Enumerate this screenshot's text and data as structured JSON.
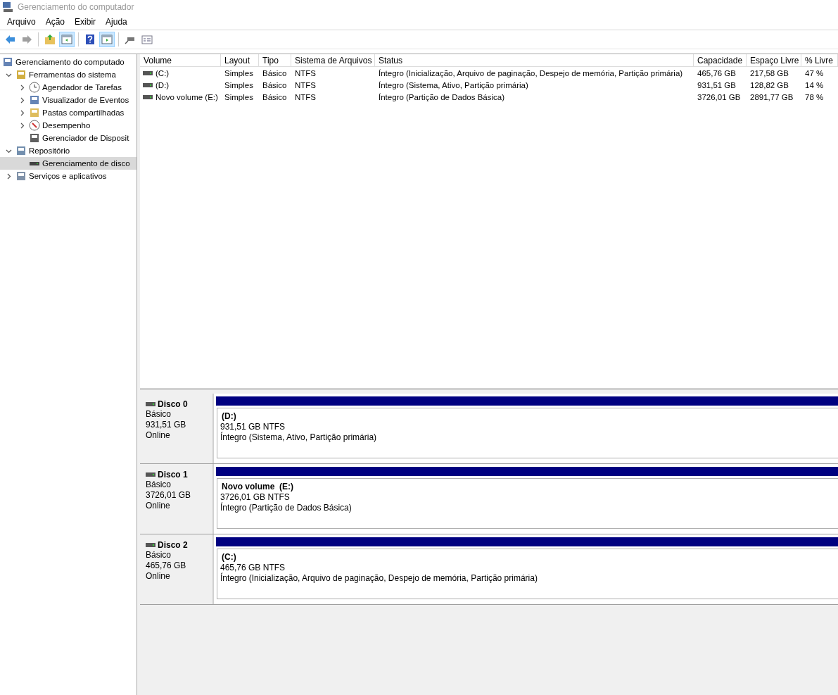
{
  "window": {
    "title": "Gerenciamento do computador"
  },
  "menu": [
    "Arquivo",
    "Ação",
    "Exibir",
    "Ajuda"
  ],
  "toolbar": [
    {
      "kind": "back",
      "pressed": false,
      "disabled": false
    },
    {
      "kind": "forward",
      "pressed": false,
      "disabled": true
    },
    {
      "kind": "separator"
    },
    {
      "kind": "up",
      "pressed": false,
      "disabled": false
    },
    {
      "kind": "tree",
      "pressed": true,
      "disabled": false
    },
    {
      "kind": "separator"
    },
    {
      "kind": "help",
      "pressed": false,
      "disabled": false
    },
    {
      "kind": "pane",
      "pressed": true,
      "disabled": false
    },
    {
      "kind": "separator"
    },
    {
      "kind": "connect",
      "pressed": false,
      "disabled": false
    },
    {
      "kind": "properties",
      "pressed": false,
      "disabled": false
    }
  ],
  "tree": {
    "label": "Gerenciamento do computado",
    "selected": false,
    "children": [
      {
        "label": "Ferramentas do sistema",
        "expanded": true,
        "selected": false,
        "children": [
          {
            "label": "Agendador de Tarefas",
            "expanded": false,
            "selected": false
          },
          {
            "label": "Visualizador de Eventos",
            "expanded": false,
            "selected": false
          },
          {
            "label": "Pastas compartilhadas",
            "expanded": false,
            "selected": false
          },
          {
            "label": "Desempenho",
            "expanded": false,
            "selected": false
          },
          {
            "label": "Gerenciador de Disposit",
            "selected": false
          }
        ]
      },
      {
        "label": "Repositório",
        "expanded": true,
        "selected": false,
        "children": [
          {
            "label": "Gerenciamento de disco",
            "selected": true
          }
        ]
      },
      {
        "label": "Serviços e aplicativos",
        "expanded": false,
        "selected": false
      }
    ]
  },
  "table": {
    "columns": [
      "Volume",
      "Layout",
      "Tipo",
      "Sistema de Arquivos",
      "Status",
      "Capacidade",
      "Espaço Livre",
      "% Livre"
    ],
    "rows": [
      [
        "(C:)",
        "Simples",
        "Básico",
        "NTFS",
        "Íntegro (Inicialização, Arquivo de paginação, Despejo de memória, Partição primária)",
        "465,76 GB",
        "217,58 GB",
        "47 %"
      ],
      [
        "(D:)",
        "Simples",
        "Básico",
        "NTFS",
        "Íntegro (Sistema, Ativo, Partição primária)",
        "931,51 GB",
        "128,82 GB",
        "14 %"
      ],
      [
        "Novo volume (E:)",
        "Simples",
        "Básico",
        "NTFS",
        "Íntegro (Partição de Dados Básica)",
        "3726,01 GB",
        "2891,77 GB",
        "78 %"
      ]
    ]
  },
  "disks": [
    {
      "name": "Disco 0",
      "type": "Básico",
      "size": "931,51 GB",
      "state": "Online",
      "partition": {
        "label": "(D:)",
        "size": "931,51 GB NTFS",
        "status": "Íntegro (Sistema, Ativo, Partição primária)"
      }
    },
    {
      "name": "Disco 1",
      "type": "Básico",
      "size": "3726,01 GB",
      "state": "Online",
      "partition": {
        "label": "Novo volume  (E:)",
        "size": "3726,01 GB NTFS",
        "status": "Íntegro (Partição de Dados Básica)"
      }
    },
    {
      "name": "Disco 2",
      "type": "Básico",
      "size": "465,76 GB",
      "state": "Online",
      "partition": {
        "label": "(C:)",
        "size": "465,76 GB NTFS",
        "status": "Íntegro (Inicialização, Arquivo de paginação, Despejo de memória, Partição primária)"
      }
    }
  ]
}
